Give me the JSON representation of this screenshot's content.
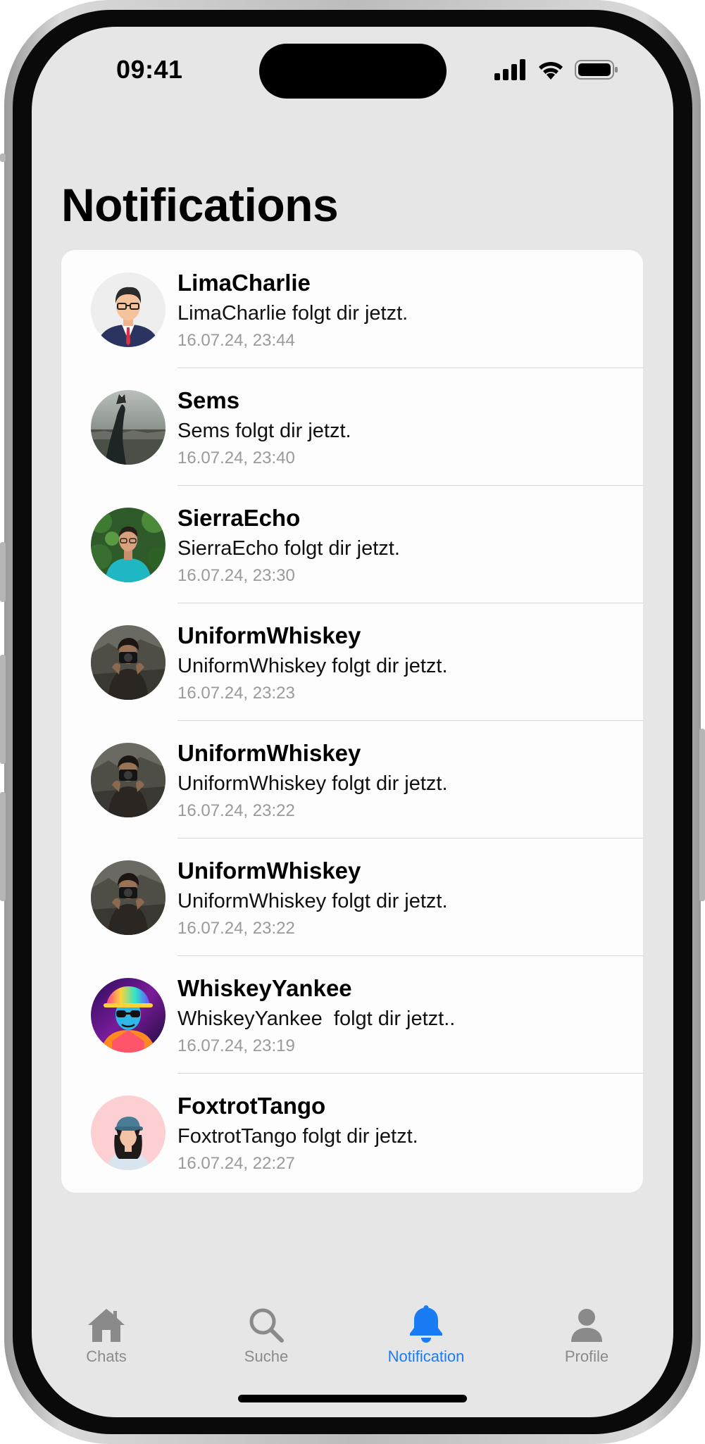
{
  "status_bar": {
    "time": "09:41"
  },
  "page": {
    "title": "Notifications"
  },
  "notifications": [
    {
      "name": "LimaCharlie",
      "message": "LimaCharlie folgt dir jetzt.",
      "time": "16.07.24, 23:44",
      "avatar_icon": "man-with-glasses-avatar-icon"
    },
    {
      "name": "Sems",
      "message": "Sems folgt dir jetzt.",
      "time": "16.07.24, 23:40",
      "avatar_icon": "hand-over-city-avatar-icon"
    },
    {
      "name": "SierraEcho",
      "message": "SierraEcho folgt dir jetzt.",
      "time": "16.07.24, 23:30",
      "avatar_icon": "man-in-turquoise-shirt-avatar-icon"
    },
    {
      "name": "UniformWhiskey",
      "message": "UniformWhiskey folgt dir jetzt.",
      "time": "16.07.24, 23:23",
      "avatar_icon": "photographer-avatar-icon"
    },
    {
      "name": "UniformWhiskey",
      "message": "UniformWhiskey folgt dir jetzt.",
      "time": "16.07.24, 23:22",
      "avatar_icon": "photographer-avatar-icon"
    },
    {
      "name": "UniformWhiskey",
      "message": "UniformWhiskey folgt dir jetzt.",
      "time": "16.07.24, 23:22",
      "avatar_icon": "photographer-avatar-icon"
    },
    {
      "name": "WhiskeyYankee",
      "message": "WhiskeyYankee  folgt dir jetzt..",
      "time": "16.07.24, 23:19",
      "avatar_icon": "colorful-sunglasses-avatar-icon"
    },
    {
      "name": "FoxtrotTango",
      "message": "FoxtrotTango folgt dir jetzt.",
      "time": "16.07.24, 22:27",
      "avatar_icon": "woman-with-cap-avatar-icon"
    }
  ],
  "tabbar": {
    "tabs": [
      {
        "label": "Chats",
        "icon": "house-icon",
        "active": false
      },
      {
        "label": "Suche",
        "icon": "magnifying-glass-icon",
        "active": false
      },
      {
        "label": "Notification",
        "icon": "bell-icon",
        "active": true
      },
      {
        "label": "Profile",
        "icon": "person-icon",
        "active": false
      }
    ]
  },
  "colors": {
    "accent": "#1a7cf5",
    "inactive": "#8a8a8a",
    "background": "#e6e6e6",
    "card": "#fdfdfd"
  }
}
